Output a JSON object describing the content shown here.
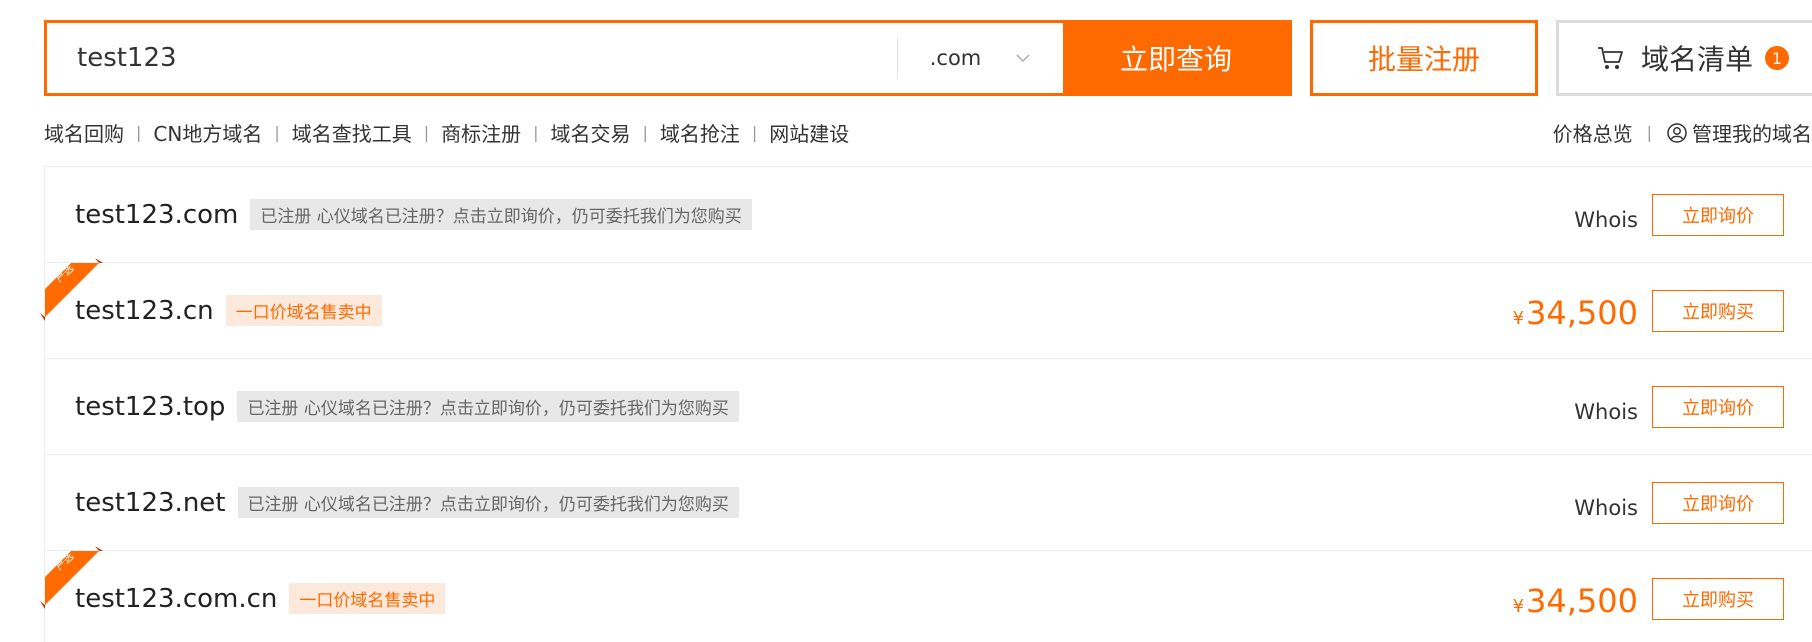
{
  "search": {
    "value": "test123",
    "suffix": ".com",
    "query_label": "立即查询",
    "bulk_label": "批量注册",
    "cart_label": "域名清单",
    "cart_count": "1"
  },
  "subnav": {
    "items": [
      "域名回购",
      "CN地方域名",
      "域名查找工具",
      "商标注册",
      "域名交易",
      "域名抢注",
      "网站建设"
    ],
    "separator": "|"
  },
  "rightnav": {
    "price_overview": "价格总览",
    "separator": "|",
    "manage_label": "管理我的域名"
  },
  "results": [
    {
      "domain": "test123.com",
      "status": "registered",
      "tag": "已注册 心仪域名已注册？点击立即询价，仍可委托我们为您购买",
      "whois": "Whois",
      "action": "立即询价",
      "ribbon": false
    },
    {
      "domain": "test123.cn",
      "status": "for_sale",
      "tag": "一口价域名售卖中",
      "currency": "¥",
      "price": "34,500",
      "action": "立即购买",
      "ribbon": true,
      "ribbon_text": "严选"
    },
    {
      "domain": "test123.top",
      "status": "registered",
      "tag": "已注册 心仪域名已注册？点击立即询价，仍可委托我们为您购买",
      "whois": "Whois",
      "action": "立即询价",
      "ribbon": false
    },
    {
      "domain": "test123.net",
      "status": "registered",
      "tag": "已注册 心仪域名已注册？点击立即询价，仍可委托我们为您购买",
      "whois": "Whois",
      "action": "立即询价",
      "ribbon": false
    },
    {
      "domain": "test123.com.cn",
      "status": "for_sale",
      "tag": "一口价域名售卖中",
      "currency": "¥",
      "price": "34,500",
      "action": "立即购买",
      "ribbon": true,
      "ribbon_text": "严选"
    }
  ],
  "colors": {
    "accent": "#ff6a00",
    "ribbon_dark": "#e8361e",
    "tag_gray_bg": "#e8e8e8",
    "tag_orange_bg": "#fde9dc"
  },
  "icons": {
    "suffix_dropdown": "chevron-down-icon",
    "cart": "cart-icon",
    "manage": "user-circle-icon"
  }
}
